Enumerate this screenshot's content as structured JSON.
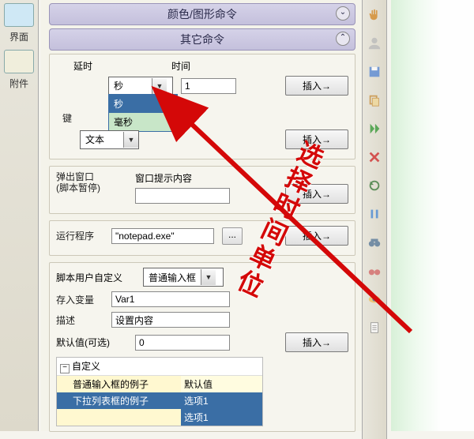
{
  "sidebar": {
    "tab1": "界面",
    "tab2": "附件"
  },
  "sections": {
    "color_shape": "颜色/图形命令",
    "other": "其它命令"
  },
  "delay": {
    "label_delay": "延时",
    "label_time": "时间",
    "unit_value": "秒",
    "options": {
      "sec": "秒",
      "ms": "毫秒"
    },
    "time_value": "1"
  },
  "key": {
    "label_short": "键",
    "type_value": "文本"
  },
  "popup": {
    "label_line1": "弹出窗口",
    "label_line2": "(脚本暂停)",
    "prompt_label": "窗口提示内容"
  },
  "run": {
    "label": "运行程序",
    "path": "\"notepad.exe\""
  },
  "custom": {
    "label": "脚本用户自定义",
    "input_type": "普通输入框",
    "store_label": "存入变量",
    "store_value": "Var1",
    "desc_label": "描述",
    "desc_value": "设置内容",
    "default_label": "默认值(可选)",
    "default_value": "0"
  },
  "tree": {
    "root": "自定义",
    "row1": {
      "c1": "普通输入框的例子",
      "c2": "默认值"
    },
    "row2": {
      "c1": "下拉列表框的例子",
      "c2": "选项1"
    },
    "row3": {
      "c2": "选项1"
    }
  },
  "buttons": {
    "insert": "插入→",
    "browse": "..."
  },
  "annotation": "选择时间单位"
}
